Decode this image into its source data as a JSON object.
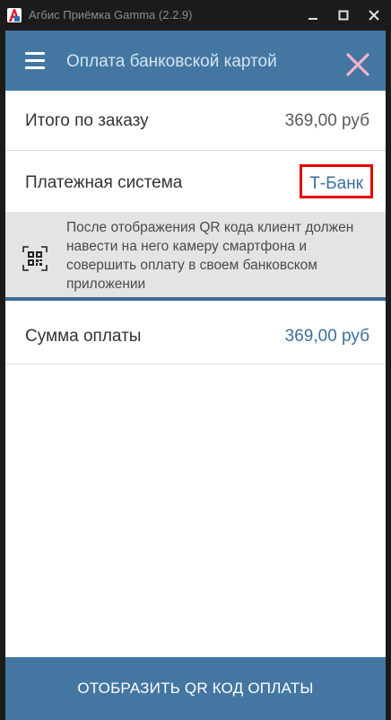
{
  "window": {
    "title": "Агбис Приёмка Gamma (2.2.9)",
    "minimize_glyph": "▬",
    "maximize_glyph": "■",
    "close_glyph": "✕"
  },
  "header": {
    "title": "Оплата банковской картой"
  },
  "order_total": {
    "label": "Итого по заказу",
    "value": "369,00 руб"
  },
  "payment_system": {
    "label": "Платежная система",
    "value": "Т-Банк"
  },
  "info": {
    "text": "После отображения QR кода клиент должен навести на него камеру смартфона и совершить оплату в своем банковском приложении"
  },
  "payment_sum": {
    "label": "Сумма оплаты",
    "value": "369,00 руб"
  },
  "footer": {
    "button_label": "ОТОБРАЗИТЬ QR КОД ОПЛАТЫ"
  },
  "colors": {
    "accent": "#4377a2",
    "link": "#3c6f9f",
    "highlight": "#e40000",
    "close_icon": "#f2b3c8"
  },
  "icons": [
    "app-logo",
    "menu-icon",
    "close-icon",
    "qr-code-icon"
  ]
}
